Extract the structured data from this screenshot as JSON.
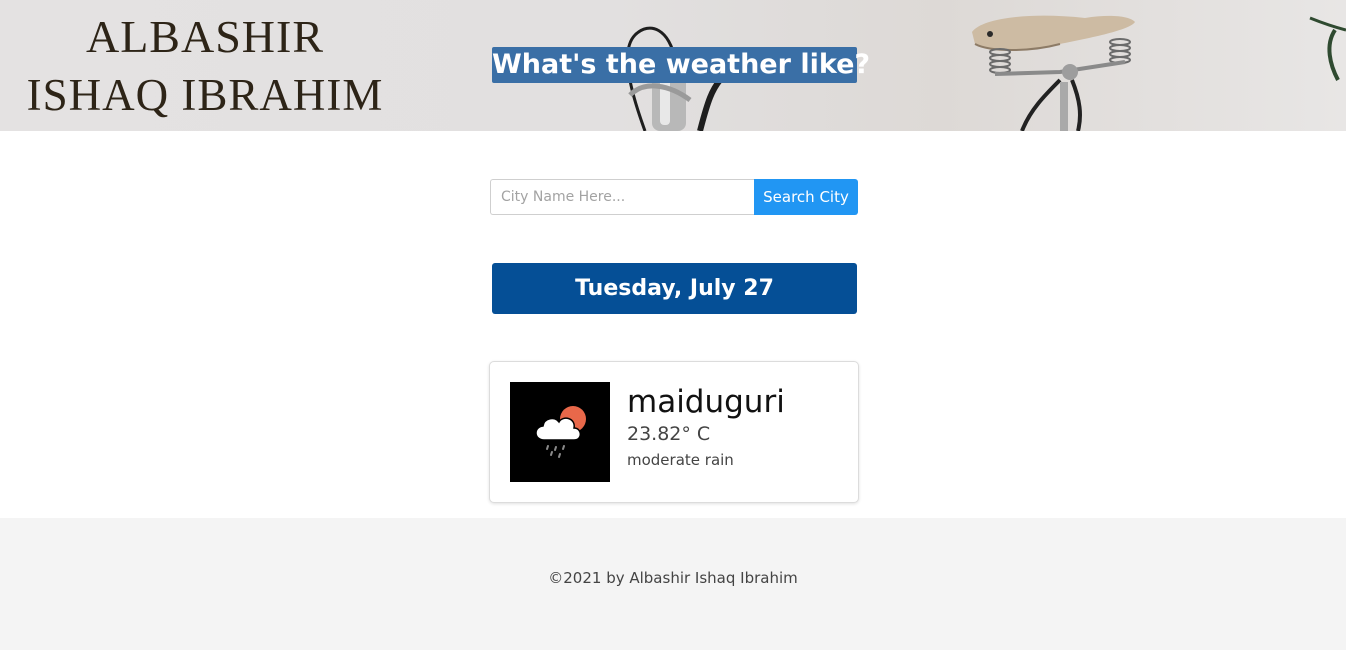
{
  "header": {
    "brand_line1": "ALBASHIR",
    "brand_line2": "ISHAQ IBRAHIM",
    "title": "What's the weather like?"
  },
  "search": {
    "placeholder": "City Name Here...",
    "value": "",
    "button_label": "Search City"
  },
  "date": {
    "label": "Tuesday, July 27"
  },
  "weather": {
    "icon": "rain-cloud-sun-icon",
    "city": "maiduguri",
    "temperature": "23.82° C",
    "description": "moderate rain"
  },
  "footer": {
    "copyright": "©2021 by Albashir Ishaq Ibrahim"
  },
  "colors": {
    "title_bg": "#3a6fa6",
    "search_button": "#2196f3",
    "date_bar": "#054f96",
    "footer_bg": "#f4f4f4",
    "sun": "#e8684a"
  }
}
